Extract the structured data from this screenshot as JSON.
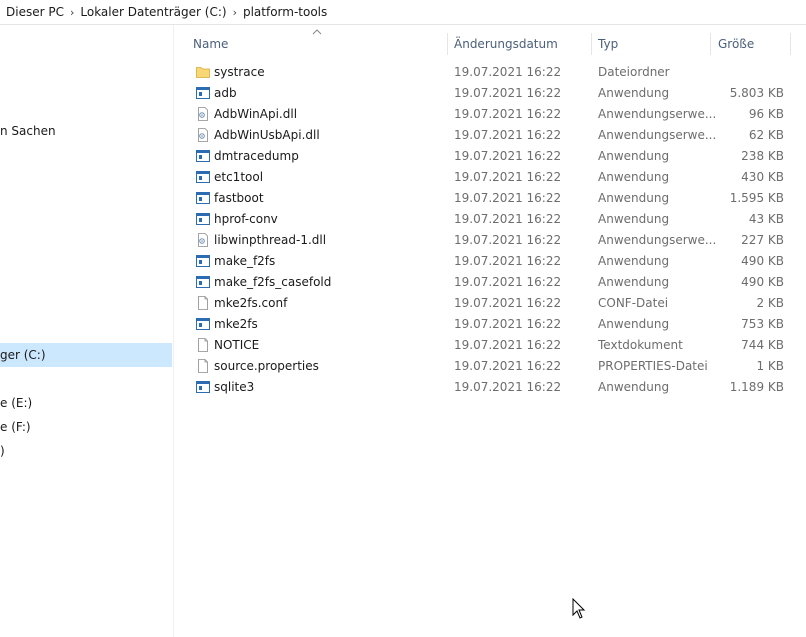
{
  "breadcrumb": {
    "items": [
      "Dieser PC",
      "Lokaler Datenträger (C:)",
      "platform-tools"
    ]
  },
  "nav": {
    "items": [
      {
        "label": "n Sachen",
        "selected": false
      },
      {
        "label": "ger (C:)",
        "selected": true
      },
      {
        "label": "e (E:)",
        "selected": false
      },
      {
        "label": "e (F:)",
        "selected": false
      },
      {
        "label": ")",
        "selected": false
      }
    ]
  },
  "columns": {
    "name": "Name",
    "date": "Änderungsdatum",
    "type": "Typ",
    "size": "Größe"
  },
  "files": [
    {
      "name": "systrace",
      "date": "19.07.2021 16:22",
      "type": "Dateiordner",
      "size": "",
      "icon": "folder-icon"
    },
    {
      "name": "adb",
      "date": "19.07.2021 16:22",
      "type": "Anwendung",
      "size": "5.803 KB",
      "icon": "application-icon"
    },
    {
      "name": "AdbWinApi.dll",
      "date": "19.07.2021 16:22",
      "type": "Anwendungserwe...",
      "size": "96 KB",
      "icon": "dll-icon"
    },
    {
      "name": "AdbWinUsbApi.dll",
      "date": "19.07.2021 16:22",
      "type": "Anwendungserwe...",
      "size": "62 KB",
      "icon": "dll-icon"
    },
    {
      "name": "dmtracedump",
      "date": "19.07.2021 16:22",
      "type": "Anwendung",
      "size": "238 KB",
      "icon": "application-icon"
    },
    {
      "name": "etc1tool",
      "date": "19.07.2021 16:22",
      "type": "Anwendung",
      "size": "430 KB",
      "icon": "application-icon"
    },
    {
      "name": "fastboot",
      "date": "19.07.2021 16:22",
      "type": "Anwendung",
      "size": "1.595 KB",
      "icon": "application-icon"
    },
    {
      "name": "hprof-conv",
      "date": "19.07.2021 16:22",
      "type": "Anwendung",
      "size": "43 KB",
      "icon": "application-icon"
    },
    {
      "name": "libwinpthread-1.dll",
      "date": "19.07.2021 16:22",
      "type": "Anwendungserwe...",
      "size": "227 KB",
      "icon": "dll-icon"
    },
    {
      "name": "make_f2fs",
      "date": "19.07.2021 16:22",
      "type": "Anwendung",
      "size": "490 KB",
      "icon": "application-icon"
    },
    {
      "name": "make_f2fs_casefold",
      "date": "19.07.2021 16:22",
      "type": "Anwendung",
      "size": "490 KB",
      "icon": "application-icon"
    },
    {
      "name": "mke2fs.conf",
      "date": "19.07.2021 16:22",
      "type": "CONF-Datei",
      "size": "2 KB",
      "icon": "document-icon"
    },
    {
      "name": "mke2fs",
      "date": "19.07.2021 16:22",
      "type": "Anwendung",
      "size": "753 KB",
      "icon": "application-icon"
    },
    {
      "name": "NOTICE",
      "date": "19.07.2021 16:22",
      "type": "Textdokument",
      "size": "744 KB",
      "icon": "document-icon"
    },
    {
      "name": "source.properties",
      "date": "19.07.2021 16:22",
      "type": "PROPERTIES-Datei",
      "size": "1 KB",
      "icon": "document-icon"
    },
    {
      "name": "sqlite3",
      "date": "19.07.2021 16:22",
      "type": "Anwendung",
      "size": "1.189 KB",
      "icon": "application-icon"
    }
  ],
  "colors": {
    "selection": "#cce8ff",
    "header_text": "#4c607a",
    "folder": "#f8d775",
    "app_blue": "#2b6cb3"
  }
}
